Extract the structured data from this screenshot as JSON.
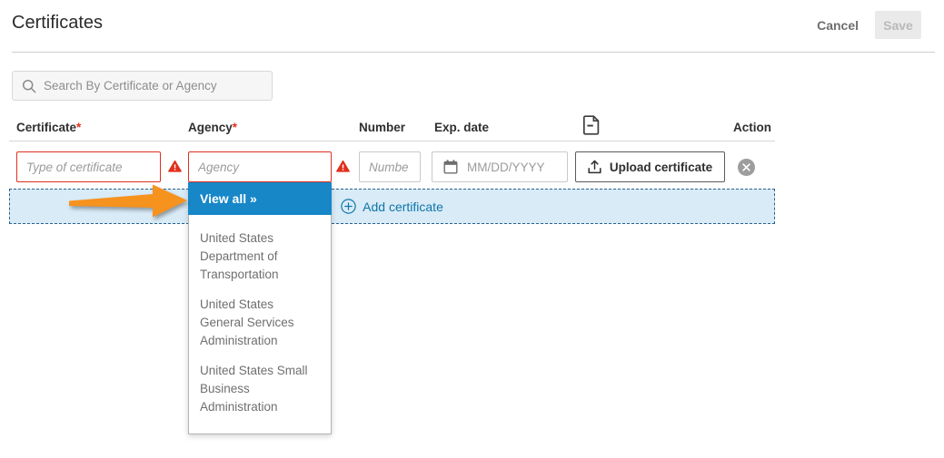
{
  "page": {
    "title": "Certificates",
    "cancel_label": "Cancel",
    "save_label": "Save"
  },
  "search": {
    "placeholder": "Search By Certificate or Agency"
  },
  "table": {
    "headers": {
      "certificate": "Certificate",
      "agency": "Agency",
      "required_mark": "*",
      "number": "Number",
      "exp_date": "Exp. date",
      "file_column_icon": "document-icon",
      "action": "Action"
    },
    "row": {
      "certificate_value": "",
      "certificate_placeholder": "Type of certificate",
      "agency_value": "",
      "agency_placeholder": "Agency",
      "number_value": "",
      "number_placeholder": "Numbe",
      "exp_date_value": "",
      "exp_date_placeholder": "MM/DD/YYYY",
      "upload_label": "Upload certificate"
    },
    "add_row_label": "Add certificate"
  },
  "dropdown": {
    "view_all_label": "View all »",
    "items": [
      "United States Department of Transportation",
      "United States General Services Administration",
      "United States Small Business Administration"
    ]
  },
  "colors": {
    "accent_blue": "#1787c8",
    "link_blue": "#0e76a8",
    "error_red": "#e0301e",
    "add_row_bg": "#d9ebf7",
    "add_row_border": "#29618e",
    "arrow_orange": "#f6921e",
    "disabled_btn_bg": "#eaeaea"
  }
}
